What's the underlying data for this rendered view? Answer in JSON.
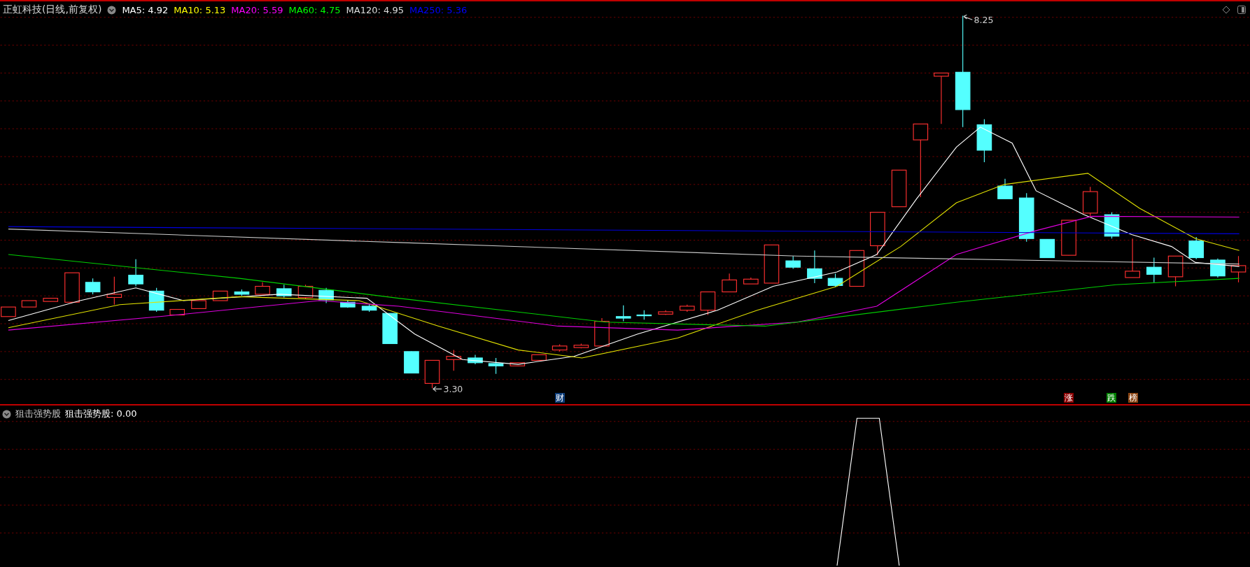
{
  "header": {
    "stock": "正虹科技(日线,前复权)",
    "ma": [
      {
        "label": "MA5: 4.92",
        "color": "#ffffff"
      },
      {
        "label": "MA10: 5.13",
        "color": "#ffff00"
      },
      {
        "label": "MA20: 5.59",
        "color": "#ff00ff"
      },
      {
        "label": "MA60: 4.75",
        "color": "#00ff00"
      },
      {
        "label": "MA120: 4.95",
        "color": "#dddddd"
      },
      {
        "label": "MA250: 5.36",
        "color": "#0000ff"
      }
    ]
  },
  "chart_labels": {
    "high": "8.25",
    "low": "3.30"
  },
  "markers": [
    {
      "text": "财",
      "color": "#0c3c78"
    },
    {
      "text": "涨",
      "color": "#8b0000"
    },
    {
      "text": "跌",
      "color": "#008000"
    },
    {
      "text": "榜",
      "color": "#8b4513"
    }
  ],
  "indicator": {
    "title": "狙击强势股",
    "value": "狙击强势股: 0.00"
  }
}
